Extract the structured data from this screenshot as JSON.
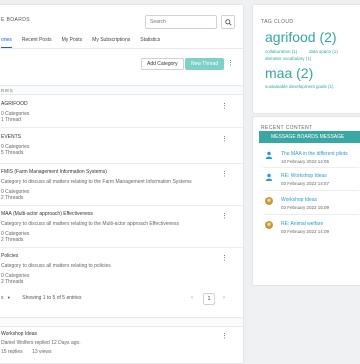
{
  "header": {
    "title": "E BOARDS",
    "search_placeholder": "Search"
  },
  "tabs": [
    {
      "label": "ories"
    },
    {
      "label": "Recent Posts"
    },
    {
      "label": "My Posts"
    },
    {
      "label": "My Subscriptions"
    },
    {
      "label": "Statistics"
    }
  ],
  "actions": {
    "add_category": "Add Category",
    "new_thread": "New Thread"
  },
  "section_label": "RIES",
  "categories": [
    {
      "title": "AGRIFOOD",
      "desc": "",
      "cats": "0 Categories",
      "threads": "1 Thread"
    },
    {
      "title": "EVENTS",
      "desc": "",
      "cats": "0 Categories",
      "threads": "5 Threads"
    },
    {
      "title": "FMIS (Farm Management Information Systems)",
      "desc": "Category to discuss all matters relating to the Farm Management Information Systems",
      "cats": "0 Categories",
      "threads": "2 Threads"
    },
    {
      "title": "MAA (Multi-actor approach) Effectiveness",
      "desc": "Category to discuss all matters relating to the Multi-actor approach Effectiveness",
      "cats": "0 Categories",
      "threads": "2 Threads"
    },
    {
      "title": "Policies",
      "desc": "Category to discuss all matters relating to policies",
      "cats": "0 Categories",
      "threads": "2 Threads"
    }
  ],
  "pager": {
    "per_page": "s",
    "summary": "Showing 1 to 5 of 5 entries",
    "page": "1"
  },
  "recent": {
    "title": "Workshop Ideas",
    "meta1": "Daniel Wolfers replied 12 Days ago.",
    "meta2": "15 replies",
    "meta3": "13 views"
  },
  "tag_cloud": {
    "title": "TAG CLOUD",
    "tags": [
      {
        "label": "agrifood (2)"
      },
      {
        "label": "collaboration (1)"
      },
      {
        "label": "data space (1)"
      },
      {
        "label": "demeter vocabulary (1)"
      },
      {
        "label": "maa (2)"
      },
      {
        "label": "sustainable development goals (1)"
      }
    ]
  },
  "recent_content": {
    "title": "RECENT CONTENT",
    "bar": "MESSAGE BOARDS MESSAGE",
    "items": [
      {
        "title": "The MAA in the different pilots",
        "date": "10 February 2022 14:05"
      },
      {
        "title": "RE: Workshop Ideas",
        "date": "03 February 2022 14:57"
      },
      {
        "title": "Workshop Ideas",
        "date": "03 February 2022 15:09"
      },
      {
        "title": "RE: Animal welfare",
        "date": "03 February 2022 14:09"
      }
    ]
  },
  "colors": {
    "accent": "#3aa8a2",
    "tag": "#34a6a0",
    "primary_btn": "#7fd0c7",
    "link": "#2a9bd6"
  }
}
